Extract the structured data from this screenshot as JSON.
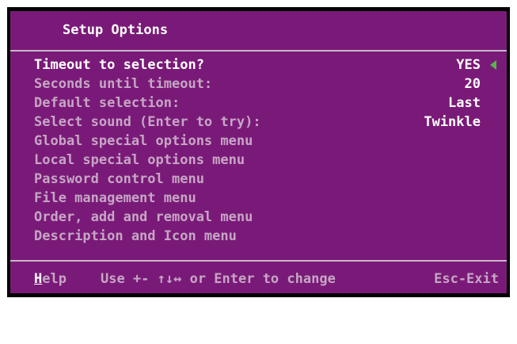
{
  "window": {
    "title": "Setup Options"
  },
  "colors": {
    "panel": "#7a1a78",
    "text_dim": "#c6a6c5",
    "text_bright": "#ffffff",
    "cursor": "#55b84a",
    "frame": "#000000"
  },
  "menu": {
    "selected_index": 0,
    "items": [
      {
        "label": "Timeout to selection?",
        "value": "YES"
      },
      {
        "label": "Seconds until timeout:",
        "value": "20"
      },
      {
        "label": "Default selection:",
        "value": "Last"
      },
      {
        "label": "Select sound (Enter to try):",
        "value": "Twinkle"
      },
      {
        "label": "Global special options menu"
      },
      {
        "label": "Local special options menu"
      },
      {
        "label": "Password control menu"
      },
      {
        "label": "File management menu"
      },
      {
        "label": "Order, add and removal menu"
      },
      {
        "label": "Description and Icon menu"
      }
    ]
  },
  "footer": {
    "help_hotkey": "H",
    "help_rest": "elp",
    "hint": "Use +- ↑↓↔ or Enter to change",
    "exit": "Esc-Exit"
  },
  "icons": {
    "selection_cursor": "triangle-left-icon"
  }
}
